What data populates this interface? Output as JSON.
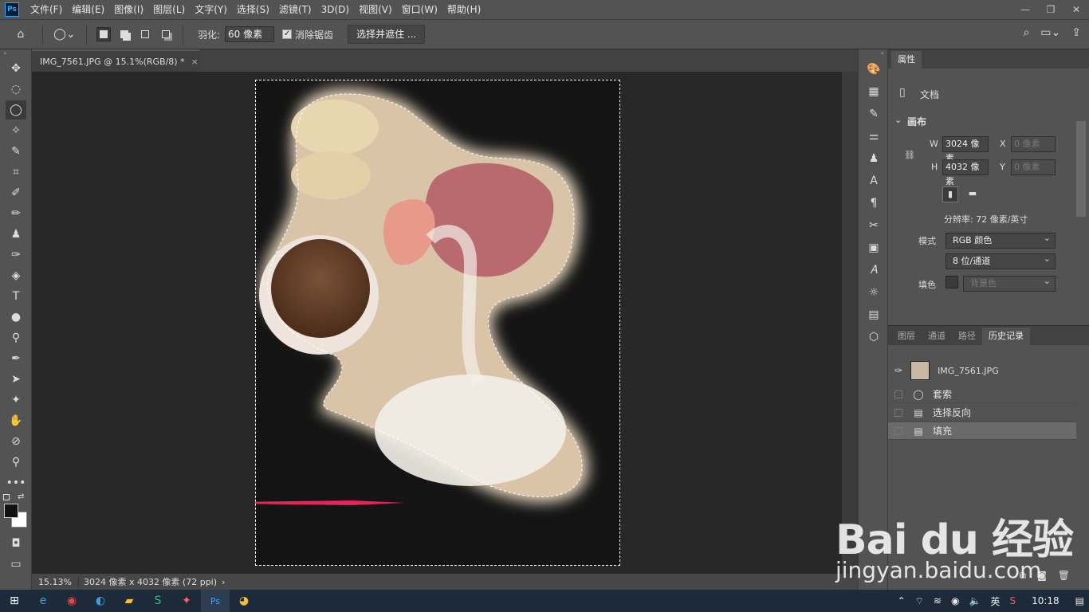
{
  "menubar": {
    "logo": "Ps",
    "items": [
      "文件(F)",
      "编辑(E)",
      "图像(I)",
      "图层(L)",
      "文字(Y)",
      "选择(S)",
      "滤镜(T)",
      "3D(D)",
      "视图(V)",
      "窗口(W)",
      "帮助(H)"
    ]
  },
  "options": {
    "feather_label": "羽化:",
    "feather_value": "60 像素",
    "antialias_label": "消除锯齿",
    "select_mask_label": "选择并遮住 ..."
  },
  "document": {
    "tab_title": "IMG_7561.JPG @ 15.1%(RGB/8) *",
    "zoom": "15.13%",
    "info": "3024 像素 x 4032 像素 (72 ppi)"
  },
  "properties": {
    "tab_label": "属性",
    "doc_label": "文档",
    "canvas_section": "画布",
    "w_label": "W",
    "w_value": "3024 像素",
    "h_label": "H",
    "h_value": "4032 像素",
    "x_label": "X",
    "x_value": "0 像素",
    "y_label": "Y",
    "y_value": "0 像素",
    "resolution": "分辨率: 72 像素/英寸",
    "mode_label": "模式",
    "mode_value": "RGB 颜色",
    "depth_value": "8 位/通道",
    "fill_label": "填色",
    "fill_value": "背景色"
  },
  "layers_panel": {
    "tabs": [
      "图层",
      "通道",
      "路径",
      "历史记录"
    ],
    "snapshot": "IMG_7561.JPG",
    "history": [
      "套索",
      "选择反向",
      "填充"
    ]
  },
  "taskbar": {
    "ime": "英",
    "time": "10:18"
  },
  "watermark": {
    "brand": "Bai du 经验",
    "url": "jingyan.baidu.com"
  },
  "colors": {
    "accent_arrow": "#e8245a",
    "ps_blue": "#31a8ff"
  }
}
